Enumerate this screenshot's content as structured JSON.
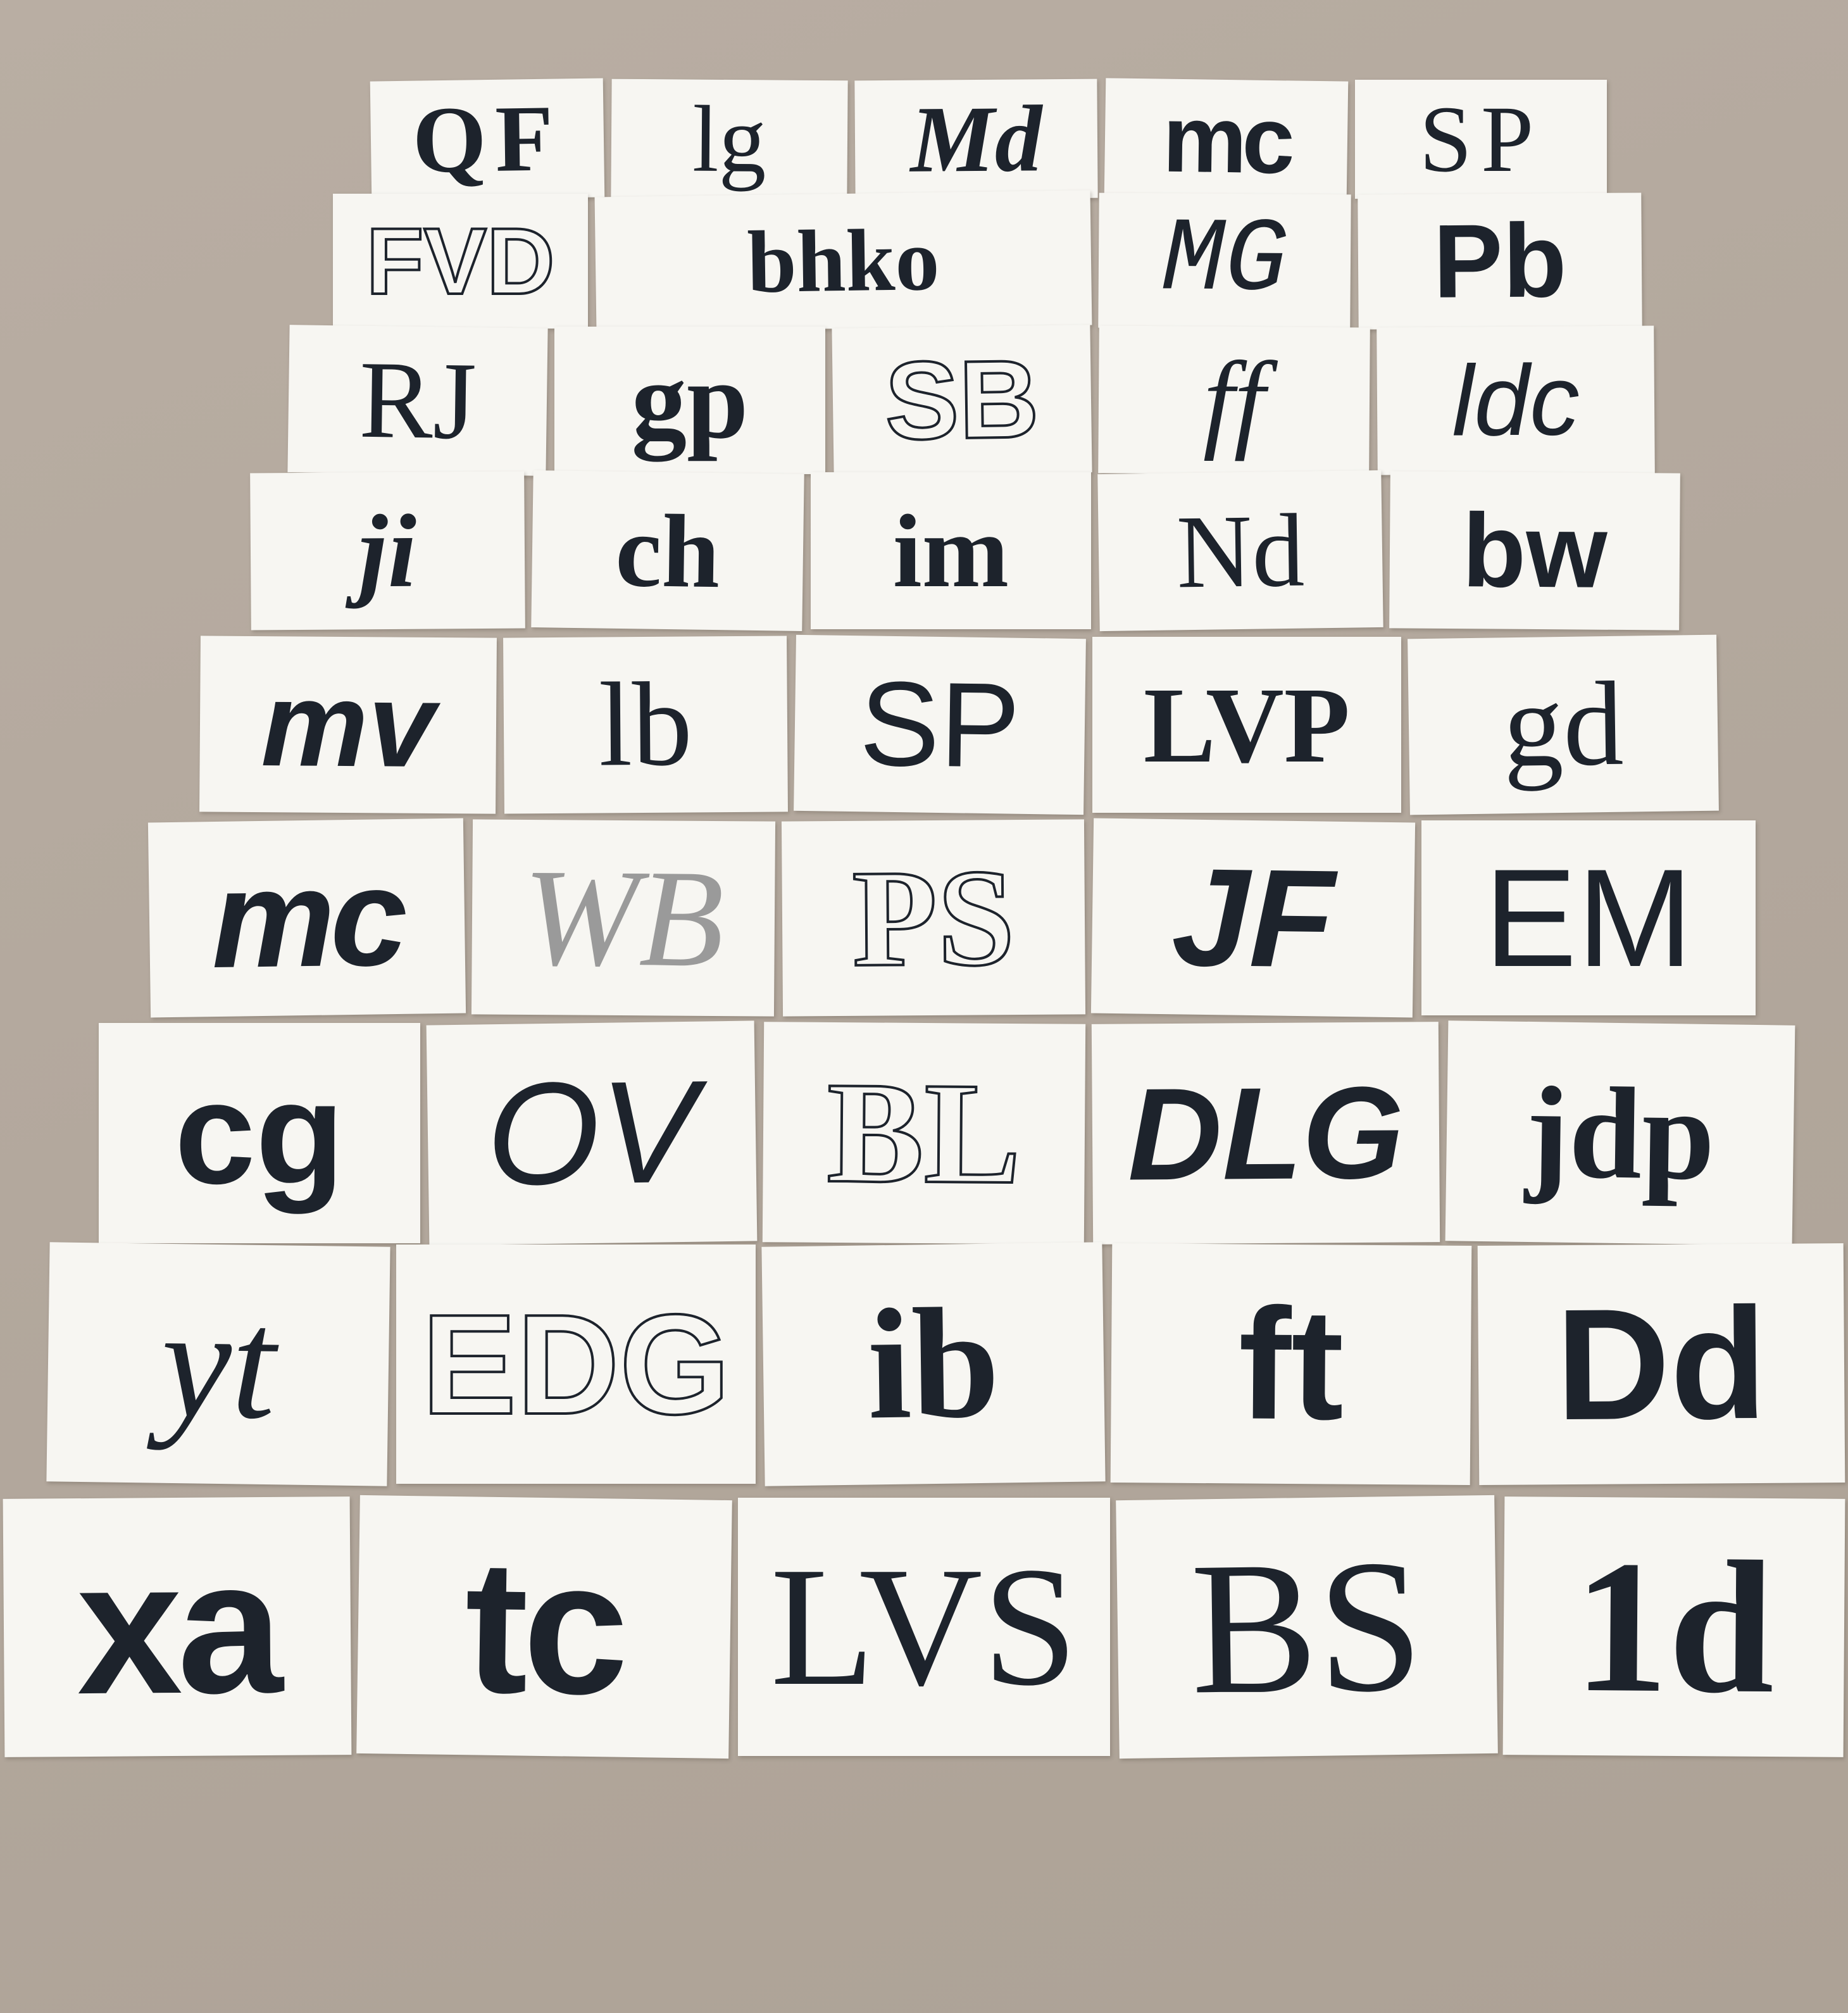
{
  "scene": {
    "colors": {
      "floor": "#b3a89d",
      "paper": "#f7f6f2",
      "ink": "#1d232c"
    }
  },
  "rows": [
    {
      "sheets": [
        {
          "text": "QF",
          "style": "serif wide"
        },
        {
          "text": "lg",
          "style": "serif thin"
        },
        {
          "text": "Md",
          "style": "serif ital"
        },
        {
          "text": "mc",
          "style": "sans cond"
        },
        {
          "text": "SP",
          "style": "serif thin wide"
        }
      ]
    },
    {
      "sheets": [
        {
          "text": "FVD",
          "style": "sans outline"
        },
        {
          "text": "bhko",
          "style": "serif"
        },
        {
          "text": "MG",
          "style": "mono ital thin"
        },
        {
          "text": "Pb",
          "style": "sans"
        }
      ]
    },
    {
      "sheets": [
        {
          "text": "RJ",
          "style": "serif thin"
        },
        {
          "text": "gp",
          "style": "serif"
        },
        {
          "text": "SB",
          "style": "sans outline"
        },
        {
          "text": "ff",
          "style": "serif ital thin"
        },
        {
          "text": "ldc",
          "style": "sans ital thin"
        }
      ]
    },
    {
      "sheets": [
        {
          "text": "ji",
          "style": "serif ital"
        },
        {
          "text": "ch",
          "style": "serif"
        },
        {
          "text": "im",
          "style": "serif"
        },
        {
          "text": "Nd",
          "style": "serif thin"
        },
        {
          "text": "bw",
          "style": "sans"
        }
      ]
    },
    {
      "sheets": [
        {
          "text": "mv",
          "style": "sans ital"
        },
        {
          "text": "lb",
          "style": "serif thin"
        },
        {
          "text": "SP",
          "style": "sans thin"
        },
        {
          "text": "LVP",
          "style": "serif"
        },
        {
          "text": "gd",
          "style": "serif thin"
        }
      ]
    },
    {
      "sheets": [
        {
          "text": "mc",
          "style": "sans ital cond"
        },
        {
          "text": "WB",
          "style": "serif grey ital"
        },
        {
          "text": "PS",
          "style": "serif outline"
        },
        {
          "text": "JF",
          "style": "sans ital"
        },
        {
          "text": "EM",
          "style": "sans thin"
        }
      ]
    },
    {
      "sheets": [
        {
          "text": "cg",
          "style": "sans"
        },
        {
          "text": "OV",
          "style": "sans ital thin"
        },
        {
          "text": "BL",
          "style": "serif outline"
        },
        {
          "text": "DLG",
          "style": "sans ital"
        },
        {
          "text": "jdp",
          "style": "serif"
        }
      ]
    },
    {
      "sheets": [
        {
          "text": "yt",
          "style": "serif ital thin"
        },
        {
          "text": "EDG",
          "style": "sans outline"
        },
        {
          "text": "ib",
          "style": "serif"
        },
        {
          "text": "ft",
          "style": "sans"
        },
        {
          "text": "Dd",
          "style": "sans"
        }
      ]
    },
    {
      "sheets": [
        {
          "text": "xa",
          "style": "sans cond"
        },
        {
          "text": "tc",
          "style": "sans cond"
        },
        {
          "text": "LVS",
          "style": "serif thin"
        },
        {
          "text": "BS",
          "style": "serif thin"
        },
        {
          "text": "1d",
          "style": "serif"
        }
      ]
    }
  ]
}
